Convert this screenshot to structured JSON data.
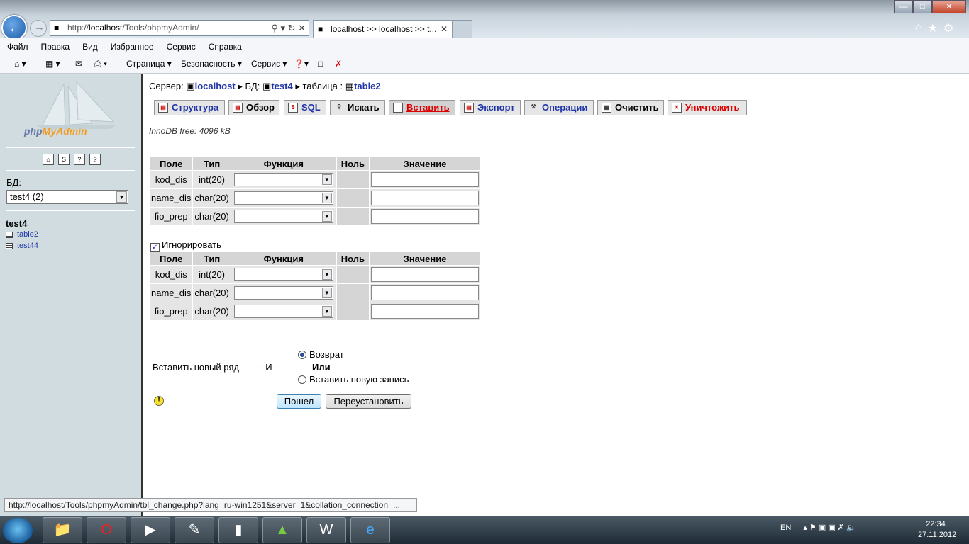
{
  "browser": {
    "url_prefix": "http://",
    "url_host": "localhost",
    "url_path": "/Tools/phpmyAdmin/",
    "tab_title": "localhost >> localhost >> t...",
    "menu": [
      "Файл",
      "Правка",
      "Вид",
      "Избранное",
      "Сервис",
      "Справка"
    ],
    "cmd_page": "Страница",
    "cmd_security": "Безопасность",
    "cmd_service": "Сервис",
    "status_url": "http://localhost/Tools/phpmyAdmin/tbl_change.php?lang=ru-win1251&server=1&collation_connection=..."
  },
  "sidebar": {
    "logo_php": "php",
    "logo_myadmin": "MyAdmin",
    "db_label": "БД:",
    "db_select": "test4 (2)",
    "db_name": "test4",
    "tables": [
      "table2",
      "test44"
    ]
  },
  "main": {
    "breadcrumb": {
      "server_label": "Сервер:",
      "server": "localhost",
      "db_label": "БД:",
      "db": "test4",
      "table_label": "таблица :",
      "table": "table2"
    },
    "tabs": [
      "Структура",
      "Обзор",
      "SQL",
      "Искать",
      "Вставить",
      "Экспорт",
      "Операции",
      "Очистить",
      "Уничтожить"
    ],
    "innodb": "InnoDB free: 4096 kB",
    "columns": [
      "Поле",
      "Тип",
      "Функция",
      "Ноль",
      "Значение"
    ],
    "rows": [
      {
        "field": "kod_dis",
        "type": "int(20)"
      },
      {
        "field": "name_dis",
        "type": "char(20)"
      },
      {
        "field": "fio_prep",
        "type": "char(20)"
      }
    ],
    "ignore_label": "Игнорировать",
    "insert_new_row": "Вставить новый ряд",
    "and": "-- И --",
    "option_return": "Возврат",
    "or": "Или",
    "option_insert_new": "Вставить новую запись",
    "go_button": "Пошел",
    "reset_button": "Переустановить"
  },
  "taskbar": {
    "lang": "EN",
    "time": "22:34",
    "date": "27.11.2012"
  }
}
